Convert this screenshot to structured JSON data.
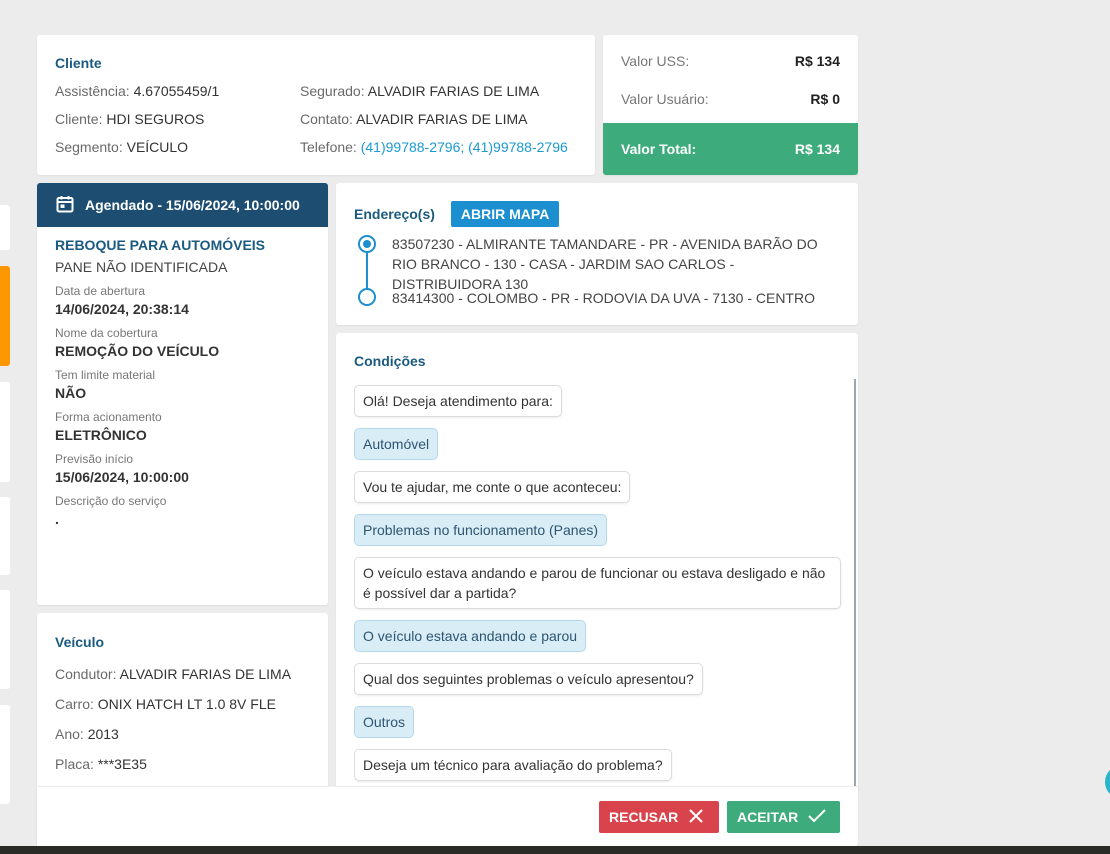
{
  "cliente": {
    "title": "Cliente",
    "assistencia_label": "Assistência:",
    "assistencia_value": "4.67055459/1",
    "cliente_label": "Cliente:",
    "cliente_value": "HDI SEGUROS",
    "segmento_label": "Segmento:",
    "segmento_value": "VEÍCULO",
    "segurado_label": "Segurado:",
    "segurado_value": "ALVADIR FARIAS DE LIMA",
    "contato_label": "Contato:",
    "contato_value": "ALVADIR FARIAS DE LIMA",
    "telefone_label": "Telefone:",
    "telefone_value": "(41)99788-2796; (41)99788-2796"
  },
  "valores": {
    "uss_label": "Valor USS:",
    "uss_value": "R$ 134",
    "usuario_label": "Valor Usuário:",
    "usuario_value": "R$ 0",
    "total_label": "Valor Total:",
    "total_value": "R$ 134"
  },
  "agendado": {
    "header": "Agendado - 15/06/2024, 10:00:00",
    "service_type": "REBOQUE PARA AUTOMÓVEIS",
    "service_sub": "PANE NÃO IDENTIFICADA",
    "fields": [
      {
        "label": "Data de abertura",
        "value": "14/06/2024, 20:38:14"
      },
      {
        "label": "Nome da cobertura",
        "value": "REMOÇÃO DO VEÍCULO"
      },
      {
        "label": "Tem limite material",
        "value": "NÃO"
      },
      {
        "label": "Forma acionamento",
        "value": "ELETRÔNICO"
      },
      {
        "label": "Previsão início",
        "value": "15/06/2024, 10:00:00"
      },
      {
        "label": "Descrição do serviço",
        "value": "."
      }
    ]
  },
  "veiculo": {
    "title": "Veículo",
    "condutor_label": "Condutor:",
    "condutor_value": "ALVADIR FARIAS DE LIMA",
    "carro_label": "Carro:",
    "carro_value": "ONIX HATCH LT 1.0 8V FLE",
    "ano_label": "Ano:",
    "ano_value": "2013",
    "placa_label": "Placa:",
    "placa_value": "***3E35"
  },
  "endereco": {
    "title": "Endereço(s)",
    "map_button": "ABRIR MAPA",
    "origin": "83507230 - ALMIRANTE TAMANDARE - PR - AVENIDA BARÃO DO RIO BRANCO - 130 - CASA - JARDIM SAO CARLOS - DISTRIBUIDORA 130",
    "destination": "83414300 - COLOMBO - PR - RODOVIA DA UVA - 7130 - CENTRO"
  },
  "condicoes": {
    "title": "Condições",
    "messages": [
      {
        "kind": "q",
        "text": "Olá! Deseja atendimento para:"
      },
      {
        "kind": "a",
        "text": "Automóvel"
      },
      {
        "kind": "q",
        "text": "Vou te ajudar, me conte o que aconteceu:"
      },
      {
        "kind": "a",
        "text": "Problemas no funcionamento (Panes)"
      },
      {
        "kind": "q",
        "text": "O veículo estava andando e parou de funcionar ou estava desligado e não é possível dar a partida?"
      },
      {
        "kind": "a",
        "text": "O veículo estava andando e parou"
      },
      {
        "kind": "q",
        "text": "Qual dos seguintes problemas o veículo apresentou?"
      },
      {
        "kind": "a",
        "text": "Outros"
      },
      {
        "kind": "q",
        "text": "Deseja um técnico para avaliação do problema?"
      }
    ]
  },
  "actions": {
    "recusar": "RECUSAR",
    "aceitar": "ACEITAR"
  },
  "colors": {
    "navy": "#1d4e72",
    "green": "#3dab7b",
    "red": "#d9444c",
    "blue": "#1b8fcf",
    "orange": "#ff9800"
  }
}
